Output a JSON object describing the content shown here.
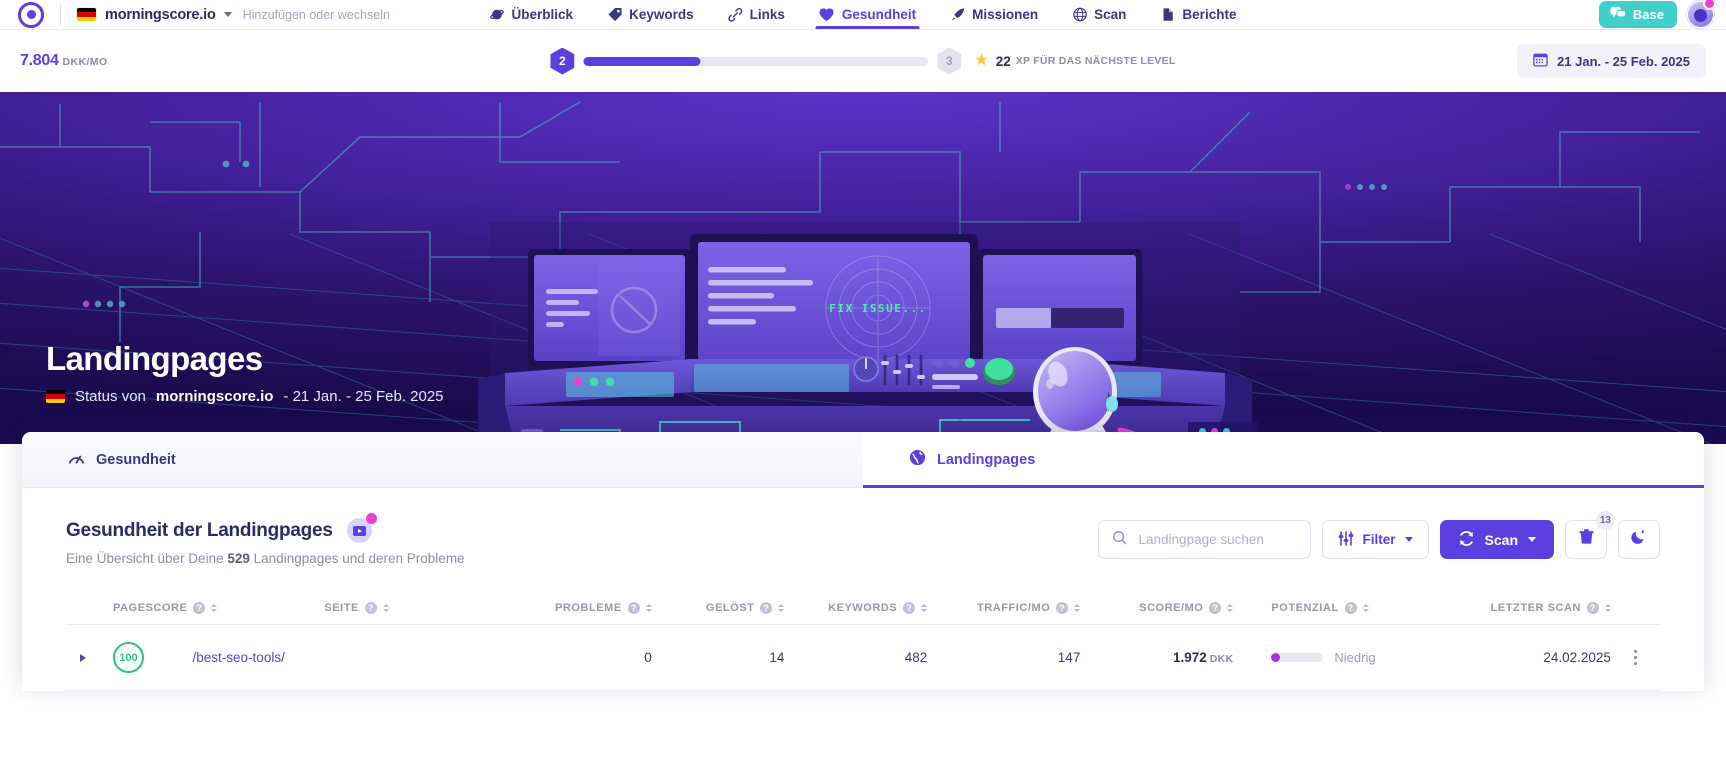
{
  "topnav": {
    "site_name": "morningscore.io",
    "add_switch": "Hinzufügen oder wechseln",
    "nav_items": [
      {
        "label": "Überblick",
        "icon": "planet-icon",
        "active": false
      },
      {
        "label": "Keywords",
        "icon": "tag-icon",
        "active": false
      },
      {
        "label": "Links",
        "icon": "link-icon",
        "active": false
      },
      {
        "label": "Gesundheit",
        "icon": "heart-icon",
        "active": true
      },
      {
        "label": "Missionen",
        "icon": "rocket-icon",
        "active": false
      },
      {
        "label": "Scan",
        "icon": "radar-icon",
        "active": false
      },
      {
        "label": "Berichte",
        "icon": "document-icon",
        "active": false
      }
    ],
    "base_button": "Base"
  },
  "subbar": {
    "revenue_value": "7.804",
    "revenue_unit": "DKK/MO",
    "level_current": "2",
    "level_next": "3",
    "xp_progress_percent": 34,
    "xp_value": "22",
    "xp_label": "XP FÜR DAS NÄCHSTE LEVEL",
    "date_range": "21 Jan. - 25 Feb. 2025"
  },
  "hero": {
    "title": "Landingpages",
    "status_prefix": "Status von",
    "site_name": "morningscore.io",
    "status_suffix": "- 21 Jan. - 25 Feb. 2025",
    "screen_text": "FIX ISSUE..."
  },
  "tabs": [
    {
      "label": "Gesundheit",
      "icon": "health-gauge-icon",
      "active": false
    },
    {
      "label": "Landingpages",
      "icon": "globe-icon",
      "active": true
    }
  ],
  "section": {
    "title": "Gesundheit der Landingpages",
    "subtitle_pre": "Eine Übersicht über Deine",
    "subtitle_count": "529",
    "subtitle_post": "Landingpages und deren Probleme"
  },
  "toolbar": {
    "search_placeholder": "Landingpage suchen",
    "search_value": "",
    "filter_label": "Filter",
    "scan_label": "Scan",
    "trash_badge": "13",
    "snooze_icon": "moon-icon"
  },
  "table": {
    "columns": [
      {
        "label": "PAGESCORE",
        "align": "left"
      },
      {
        "label": "SEITE",
        "align": "left"
      },
      {
        "label": "PROBLEME",
        "align": "right"
      },
      {
        "label": "GELÖST",
        "align": "right"
      },
      {
        "label": "KEYWORDS",
        "align": "right"
      },
      {
        "label": "TRAFFIC/MO",
        "align": "right"
      },
      {
        "label": "SCORE/MO",
        "align": "right"
      },
      {
        "label": "POTENZIAL",
        "align": "left"
      },
      {
        "label": "LETZTER SCAN",
        "align": "right"
      }
    ],
    "rows": [
      {
        "pagescore": "100",
        "seite": "/best-seo-tools/",
        "probleme": "0",
        "geloest": "14",
        "keywords": "482",
        "traffic": "147",
        "score_value": "1.972",
        "score_unit": "DKK",
        "potenzial_label": "Niedrig",
        "potenzial_percent": 16,
        "letzter_scan": "24.02.2025"
      }
    ]
  },
  "colors": {
    "brand_purple": "#5b3fe0",
    "teal": "#3fd0c9",
    "green": "#29c57f",
    "pink": "#ec3fd8",
    "magenta": "#b22ee0",
    "star_yellow": "#f7c72e",
    "hero_dark": "#1a0b4e"
  }
}
